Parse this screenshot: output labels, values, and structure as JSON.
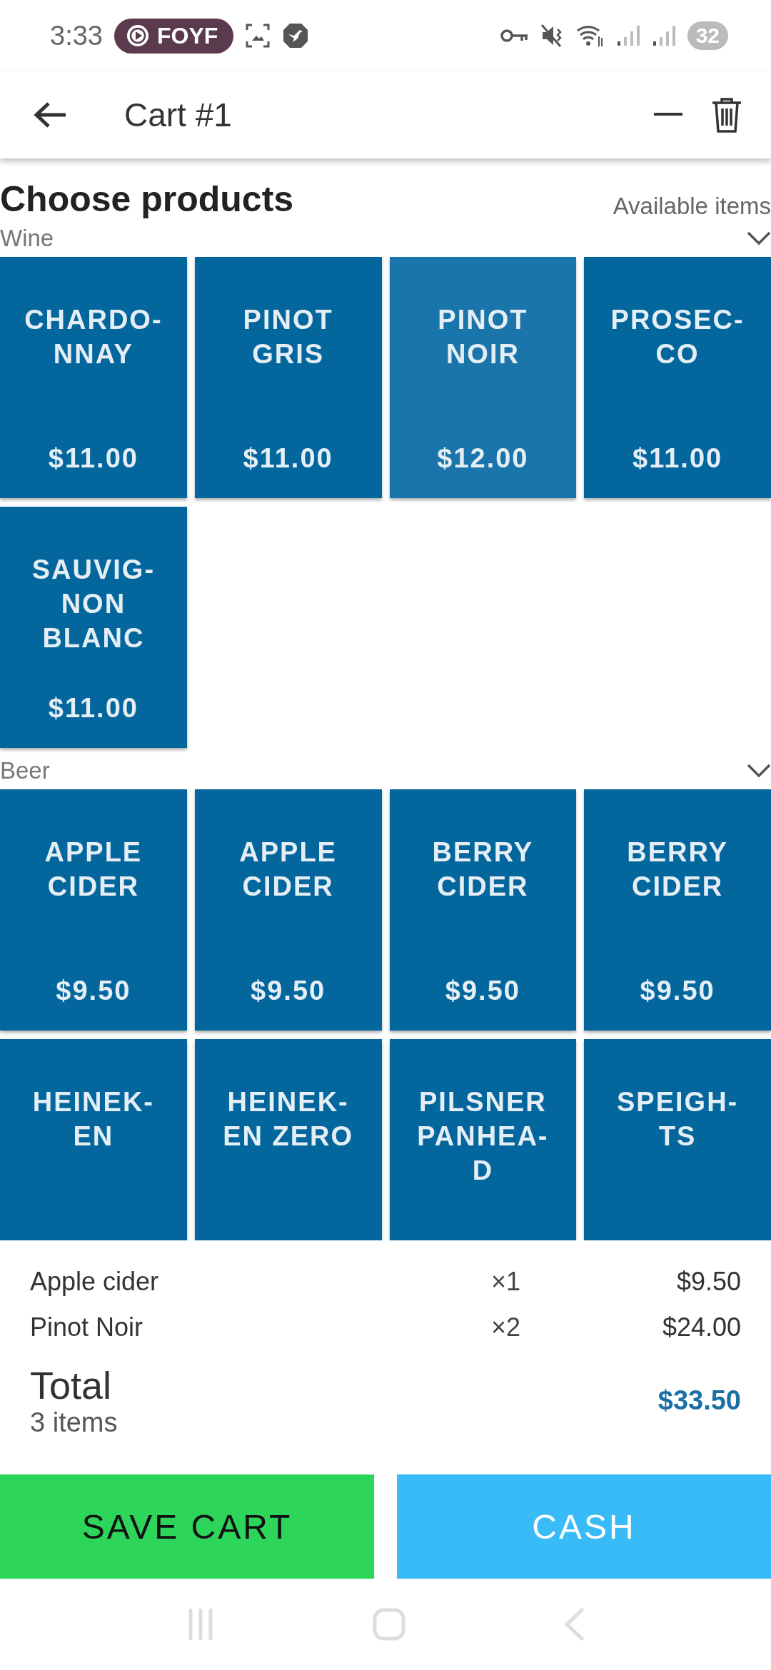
{
  "status_bar": {
    "time": "3:33",
    "badge": "FOYF",
    "battery": "32"
  },
  "app_bar": {
    "title": "Cart #1"
  },
  "products": {
    "title": "Choose products",
    "subtitle": "Available items",
    "sections": [
      {
        "name": "Wine",
        "expanded": true,
        "tiles": [
          {
            "name": "CHARDO-\nNNAY",
            "price": "$11.00",
            "highlighted": false
          },
          {
            "name": "PINOT\nGRIS",
            "price": "$11.00",
            "highlighted": false
          },
          {
            "name": "PINOT\nNOIR",
            "price": "$12.00",
            "highlighted": true
          },
          {
            "name": "PROSEC-\nCO",
            "price": "$11.00",
            "highlighted": false
          },
          {
            "name": "SAUVIG-\nNON\nBLANC",
            "price": "$11.00",
            "highlighted": false
          }
        ]
      },
      {
        "name": "Beer",
        "expanded": true,
        "tiles": [
          {
            "name": "APPLE\nCIDER",
            "price": "$9.50",
            "highlighted": false
          },
          {
            "name": "APPLE\nCIDER",
            "price": "$9.50",
            "highlighted": false
          },
          {
            "name": "BERRY\nCIDER",
            "price": "$9.50",
            "highlighted": false
          },
          {
            "name": "BERRY\nCIDER",
            "price": "$9.50",
            "highlighted": false
          },
          {
            "name": "HEINEK-\nEN",
            "highlighted": false
          },
          {
            "name": "HEINEK-\nEN ZERO",
            "highlighted": false
          },
          {
            "name": "PILSNER\nPANHEA-\nD",
            "highlighted": false
          },
          {
            "name": "SPEIGH-\nTS",
            "highlighted": false
          }
        ]
      }
    ]
  },
  "cart": {
    "lines": [
      {
        "name": "Apple cider",
        "qty": "×1",
        "amount": "$9.50"
      },
      {
        "name": "Pinot Noir",
        "qty": "×2",
        "amount": "$24.00"
      }
    ],
    "total_label": "Total",
    "count": "3 items",
    "total": "$33.50"
  },
  "buttons": [
    {
      "label": "SAVE CART",
      "kind": "save"
    },
    {
      "label": "CASH",
      "kind": "cash"
    }
  ]
}
